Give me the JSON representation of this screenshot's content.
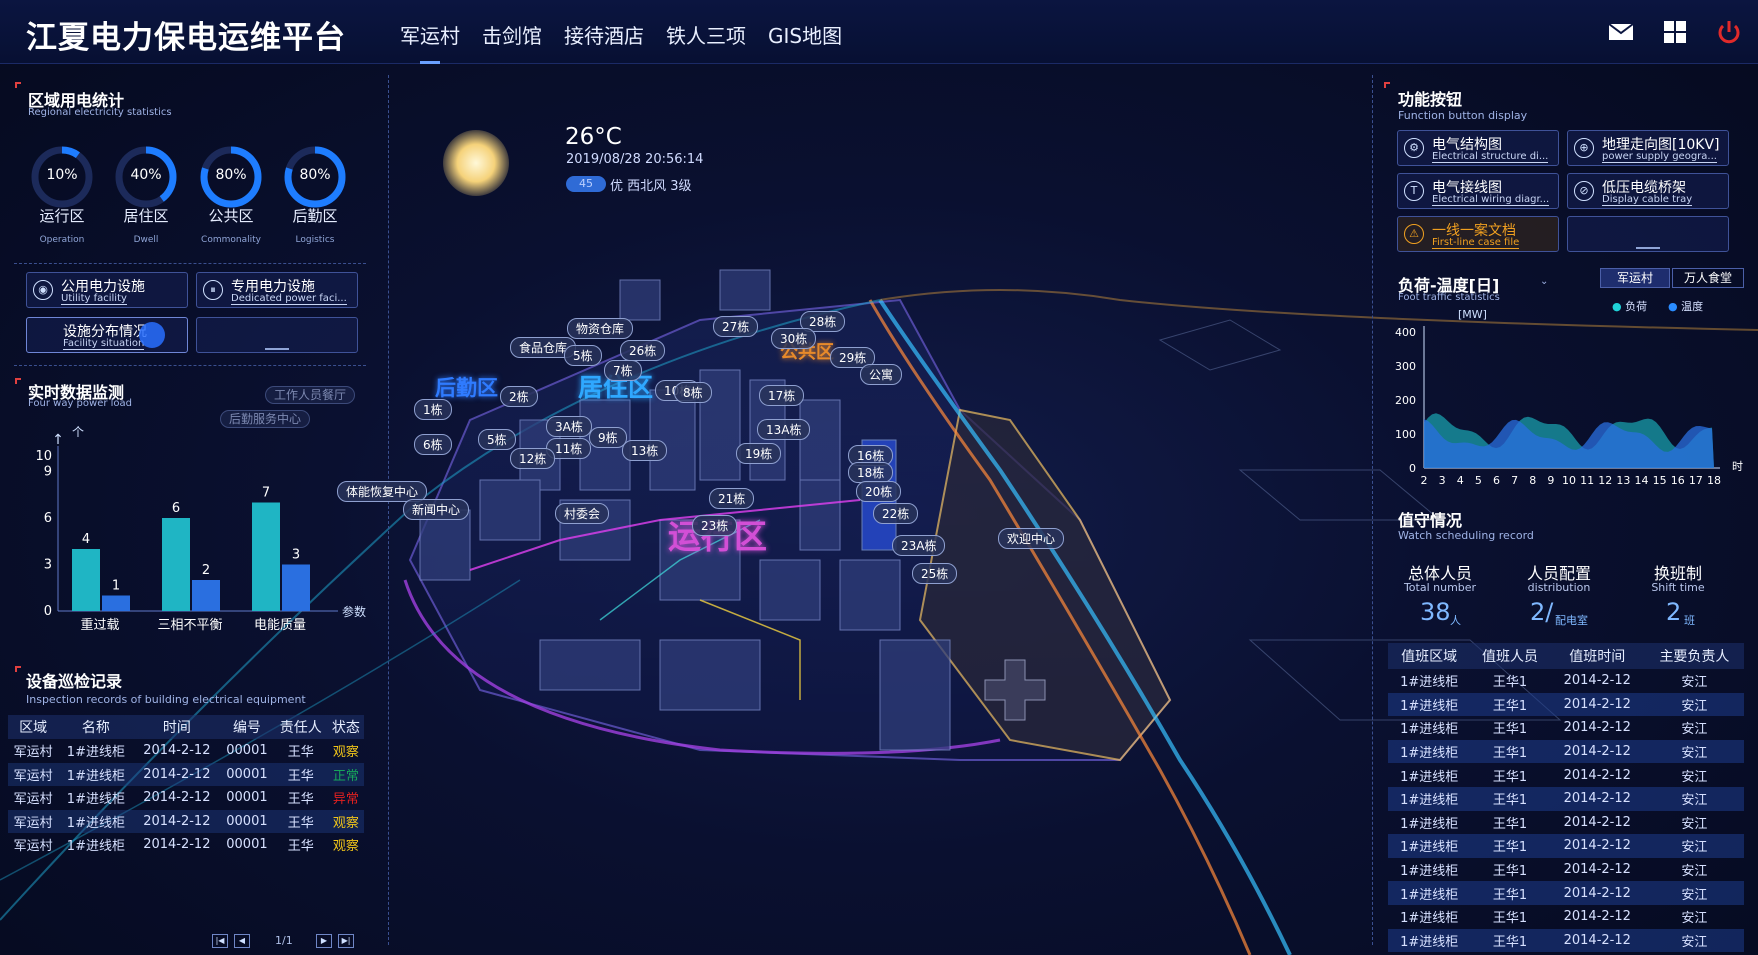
{
  "header": {
    "title": "江夏电力保电运维平台",
    "nav": [
      "军运村",
      "击剑馆",
      "接待酒店",
      "铁人三项",
      "GIS地图"
    ],
    "active_nav": "军运村",
    "icons": [
      "mail-icon",
      "grid-menu-icon",
      "power-off-icon"
    ]
  },
  "regional": {
    "title": "区域用电统计",
    "subtitle": "Regional electricity statistics",
    "gauges": [
      {
        "value": "10%",
        "pct": 10,
        "label": "运行区",
        "en": "Operation"
      },
      {
        "value": "40%",
        "pct": 40,
        "label": "居住区",
        "en": "Dwell"
      },
      {
        "value": "80%",
        "pct": 80,
        "label": "公共区",
        "en": "Commonality"
      },
      {
        "value": "80%",
        "pct": 80,
        "label": "后勤区",
        "en": "Logistics"
      }
    ]
  },
  "facility": {
    "utility_zh": "公用电力设施",
    "utility_en": "Utility facility",
    "dedicated_zh": "专用电力设施",
    "dedicated_en": "Dedicated power faci...",
    "distribution_zh": "设施分布情况",
    "distribution_en": "Facility situation"
  },
  "realtime": {
    "title": "实时数据监测",
    "subtitle": "Four way power load"
  },
  "chart_data": {
    "type": "bar",
    "categories": [
      "重过载",
      "三相不平衡",
      "电能质量"
    ],
    "series": [
      {
        "values": [
          4,
          6,
          7
        ],
        "color": "#1fb5c4"
      },
      {
        "values": [
          1,
          2,
          3
        ],
        "color": "#2a6fe0"
      }
    ],
    "xlabel": "参数",
    "ylabel": "个",
    "yticks": [
      "0",
      "3",
      "6",
      "9",
      "10"
    ],
    "ylim": [
      0,
      10
    ]
  },
  "inspection": {
    "title": "设备巡检记录",
    "subtitle": "Inspection records of building electrical equipment",
    "headers": [
      "区域",
      "名称",
      "时间",
      "编号",
      "责任人",
      "状态"
    ],
    "rows": [
      [
        "军运村",
        "1#进线柜",
        "2014-2-12",
        "00001",
        "王华",
        "观察"
      ],
      [
        "军运村",
        "1#进线柜",
        "2014-2-12",
        "00001",
        "王华",
        "正常"
      ],
      [
        "军运村",
        "1#进线柜",
        "2014-2-12",
        "00001",
        "王华",
        "异常"
      ],
      [
        "军运村",
        "1#进线柜",
        "2014-2-12",
        "00001",
        "王华",
        "观察"
      ],
      [
        "军运村",
        "1#进线柜",
        "2014-2-12",
        "00001",
        "王华",
        "观察"
      ]
    ],
    "status_colors": {
      "观察": "#f0c419",
      "正常": "#17a55a",
      "异常": "#e02020"
    },
    "page": "1/1"
  },
  "weather": {
    "temperature": "26°C",
    "datetime": "2019/08/28 20:56:14",
    "aqi": "45",
    "wind": "优 西北风 3级"
  },
  "map": {
    "zones": [
      {
        "name": "后勤区",
        "color": "#2f7bff"
      },
      {
        "name": "居住区",
        "color": "#2fa8ff"
      },
      {
        "name": "公共区",
        "color": "#e88a2a"
      },
      {
        "name": "运行区",
        "color": "#d24fd6"
      }
    ],
    "buildings": [
      "物资仓库",
      "食品仓库",
      "27栋",
      "28栋",
      "30栋",
      "29栋",
      "公寓",
      "26栋",
      "5栋",
      "7栋",
      "10栋",
      "8栋",
      "17栋",
      "2栋",
      "1栋",
      "3A栋",
      "9栋",
      "13A栋",
      "6栋",
      "5栋",
      "11栋",
      "12栋",
      "13栋",
      "19栋",
      "16栋",
      "18栋",
      "20栋",
      "22栋",
      "21栋",
      "23栋",
      "23A栋",
      "25栋",
      "体能恢复中心",
      "新闻中心",
      "村委会",
      "欢迎中心"
    ],
    "ghost": [
      "工作人员餐厅",
      "后勤服务中心"
    ]
  },
  "functions": {
    "title": "功能按钮",
    "subtitle": "Function button display",
    "buttons": [
      {
        "zh": "电气结构图",
        "en": "Electrical structure di..."
      },
      {
        "zh": "地理走向图[10KV]",
        "en": "power supply geogra..."
      },
      {
        "zh": "电气接线图",
        "en": "Electrical wiring diagr..."
      },
      {
        "zh": "低压电缆桥架",
        "en": "Display cable tray"
      },
      {
        "zh": "一线一案文档",
        "en": "First-line case file"
      }
    ]
  },
  "load_temp": {
    "title": "负荷-温度[日]",
    "subtitle": "Foot traffic statistics",
    "tabs": [
      "军运村",
      "万人食堂"
    ],
    "legend": [
      "负荷",
      "温度"
    ],
    "unit": "[MW]",
    "yticks": [
      "0",
      "100",
      "200",
      "300",
      "400"
    ],
    "xticks": [
      "2",
      "3",
      "4",
      "5",
      "6",
      "7",
      "8",
      "9",
      "10",
      "11",
      "12",
      "13",
      "14",
      "15",
      "16",
      "17",
      "18"
    ],
    "xunit": "时"
  },
  "duty": {
    "title": "值守情况",
    "subtitle": "Watch scheduling record",
    "stats": [
      {
        "zh": "总体人员",
        "en": "Total number",
        "value": "38",
        "unit": "人"
      },
      {
        "zh": "人员配置",
        "en": "distribution",
        "value": "2/",
        "unit": "配电室"
      },
      {
        "zh": "换班制",
        "en": "Shift time",
        "value": "2",
        "unit": "班"
      }
    ],
    "headers": [
      "值班区域",
      "值班人员",
      "值班时间",
      "主要负责人"
    ],
    "rows": [
      [
        "1#进线柜",
        "王华1",
        "2014-2-12",
        "安江"
      ],
      [
        "1#进线柜",
        "王华1",
        "2014-2-12",
        "安江"
      ],
      [
        "1#进线柜",
        "王华1",
        "2014-2-12",
        "安江"
      ],
      [
        "1#进线柜",
        "王华1",
        "2014-2-12",
        "安江"
      ],
      [
        "1#进线柜",
        "王华1",
        "2014-2-12",
        "安江"
      ],
      [
        "1#进线柜",
        "王华1",
        "2014-2-12",
        "安江"
      ],
      [
        "1#进线柜",
        "王华1",
        "2014-2-12",
        "安江"
      ],
      [
        "1#进线柜",
        "王华1",
        "2014-2-12",
        "安江"
      ],
      [
        "1#进线柜",
        "王华1",
        "2014-2-12",
        "安江"
      ],
      [
        "1#进线柜",
        "王华1",
        "2014-2-12",
        "安江"
      ],
      [
        "1#进线柜",
        "王华1",
        "2014-2-12",
        "安江"
      ],
      [
        "1#进线柜",
        "王华1",
        "2014-2-12",
        "安江"
      ]
    ]
  }
}
